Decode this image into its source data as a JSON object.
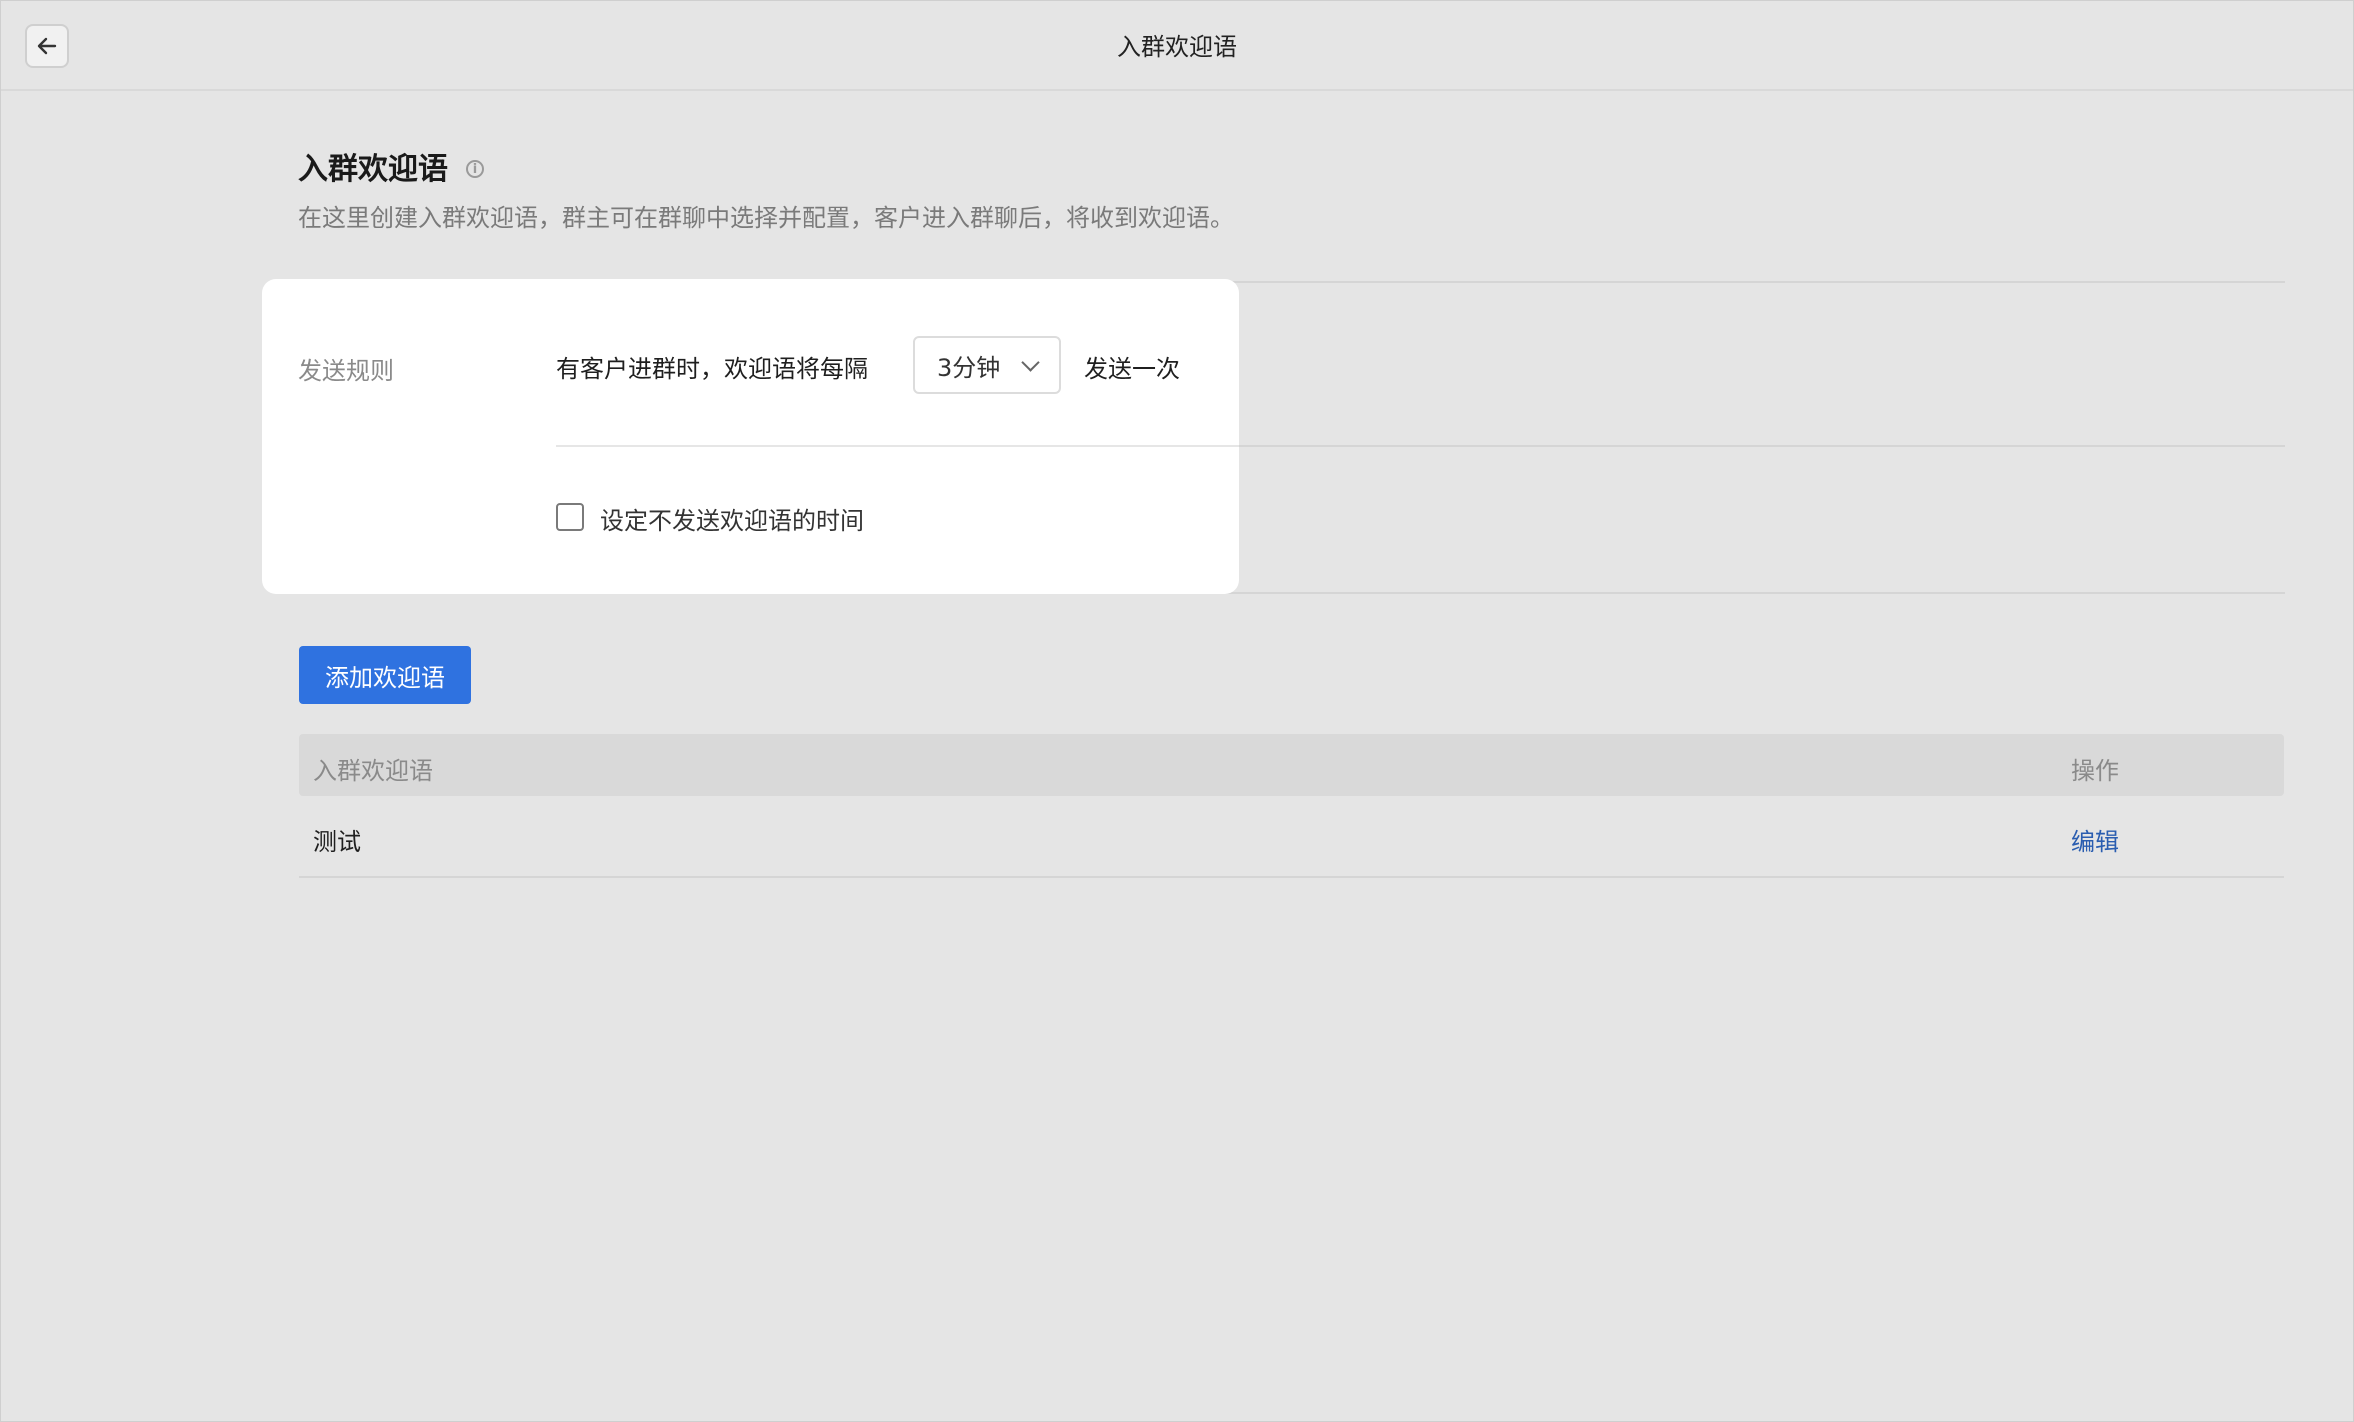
{
  "window": {
    "title": "入群欢迎语"
  },
  "page": {
    "title": "入群欢迎语",
    "description": "在这里创建入群欢迎语，群主可在群聊中选择并配置，客户进入群聊后，将收到欢迎语。"
  },
  "send_rule": {
    "label": "发送规则",
    "prefix_text": "有客户进群时，欢迎语将每隔",
    "interval_selected": "3分钟",
    "suffix_text": "发送一次",
    "no_send_time_label": "设定不发送欢迎语的时间",
    "no_send_time_checked": false
  },
  "actions": {
    "add_label": "添加欢迎语"
  },
  "table": {
    "columns": [
      "入群欢迎语",
      "操作"
    ],
    "rows": [
      {
        "message": "测试",
        "action": "编辑"
      }
    ]
  },
  "colors": {
    "primary": "#2f72e0",
    "link": "#2a5db0",
    "background": "#e5e5e5"
  }
}
